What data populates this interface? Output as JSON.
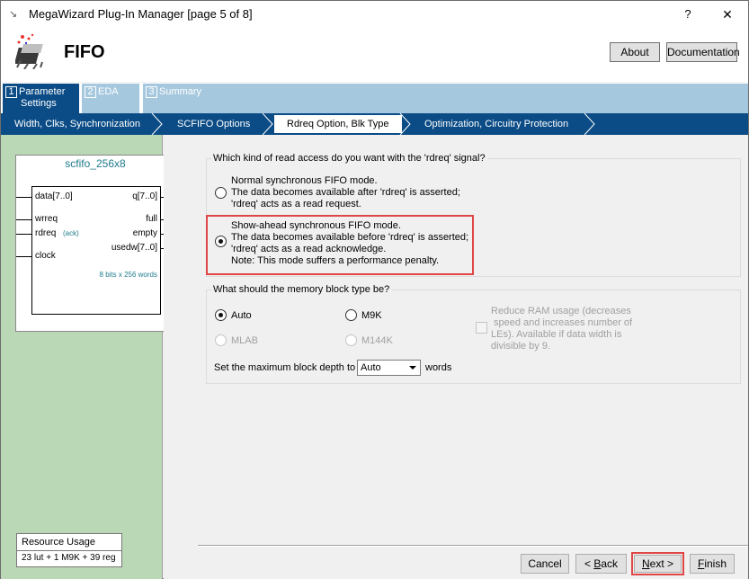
{
  "window": {
    "title": "MegaWizard Plug-In Manager [page 5 of 8]",
    "help_glyph": "?",
    "close_glyph": "✕"
  },
  "header": {
    "heading": "FIFO",
    "about_label": "About",
    "documentation_label": "Documentation"
  },
  "tabs": [
    {
      "num": "1",
      "label_line1": "Parameter",
      "label_line2": "Settings"
    },
    {
      "num": "2",
      "label_line1": "EDA"
    },
    {
      "num": "3",
      "label_line1": "Summary"
    }
  ],
  "breadcrumbs": [
    "Width, Clks, Synchronization",
    "SCFIFO Options",
    "Rdreq Option, Blk Type",
    "Optimization, Circuitry Protection"
  ],
  "symbol": {
    "name": "scfifo_256x8",
    "ports_left": [
      "data[7..0]",
      "wrreq",
      "rdreq",
      "clock"
    ],
    "rdreq_note": "(ack)",
    "ports_right": [
      "q[7..0]",
      "full",
      "empty",
      "usedw[7..0]"
    ],
    "size_note": "8 bits x 256 words"
  },
  "resource": {
    "title": "Resource Usage",
    "value": "23 lut + 1 M9K + 39 reg"
  },
  "read_access": {
    "question": "Which kind of read access do you want with the 'rdreq' signal?",
    "normal": {
      "l1": "Normal synchronous FIFO mode.",
      "l2": "The data becomes available after 'rdreq' is asserted;",
      "l3": "'rdreq' acts as a read request."
    },
    "showahead": {
      "l1": "Show-ahead synchronous FIFO mode.",
      "l2": "The data becomes available before 'rdreq' is asserted;",
      "l3": "'rdreq' acts as a read acknowledge.",
      "l4": "Note: This mode suffers a performance penalty."
    },
    "selected": "showahead"
  },
  "memory": {
    "question": "What should the memory block type be?",
    "options": [
      "Auto",
      "M9K",
      "MLAB",
      "M144K"
    ],
    "selected": "Auto",
    "reduce_ram": {
      "l1": "Reduce RAM usage (decreases",
      "l2": "speed and increases number of",
      "l3": "LEs).  Available if data width is",
      "l4": "divisible by 9."
    },
    "depth_label": "Set the maximum block depth to",
    "depth_value": "Auto",
    "depth_unit": "words"
  },
  "footer": {
    "cancel": "Cancel",
    "back_prefix": "< ",
    "back_access": "B",
    "back_rest": "ack",
    "next_access": "N",
    "next_rest": "ext >",
    "finish_access": "F",
    "finish_rest": "inish"
  },
  "colors": {
    "brand_blue": "#0b4c86",
    "tab_inactive": "#a6c8de",
    "left_panel": "#bad8b5",
    "highlight": "#e04646"
  }
}
